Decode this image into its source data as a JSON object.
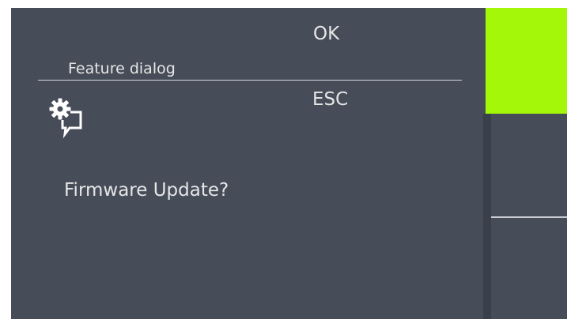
{
  "dialog": {
    "title": "Feature dialog",
    "message": "Firmware Update?",
    "icon": "gear-chat-icon"
  },
  "buttons": {
    "ok_label": "OK",
    "esc_label": "ESC"
  },
  "colors": {
    "background": "#464d59",
    "ok_accent": "#a4f709",
    "text": "#e6e6e6"
  }
}
